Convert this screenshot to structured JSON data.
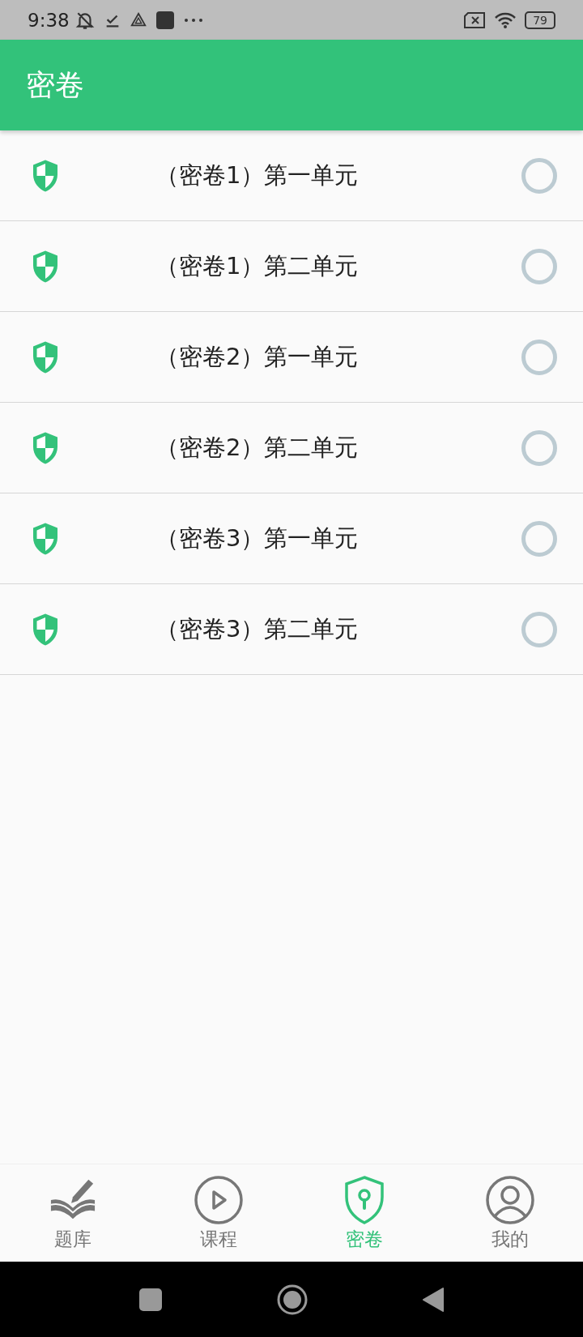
{
  "status_bar": {
    "time": "9:38",
    "battery": "79"
  },
  "app_bar": {
    "title": "密卷"
  },
  "papers": [
    {
      "title": "（密卷1）第一单元",
      "selected": false
    },
    {
      "title": "（密卷1）第二单元",
      "selected": false
    },
    {
      "title": "（密卷2）第一单元",
      "selected": false
    },
    {
      "title": "（密卷2）第二单元",
      "selected": false
    },
    {
      "title": "（密卷3）第一单元",
      "selected": false
    },
    {
      "title": "（密卷3）第二单元",
      "selected": false
    }
  ],
  "tabs": [
    {
      "label": "题库",
      "kind": "book",
      "selected": false
    },
    {
      "label": "课程",
      "kind": "play",
      "selected": false
    },
    {
      "label": "密卷",
      "kind": "shield",
      "selected": true
    },
    {
      "label": "我的",
      "kind": "user",
      "selected": false
    }
  ]
}
